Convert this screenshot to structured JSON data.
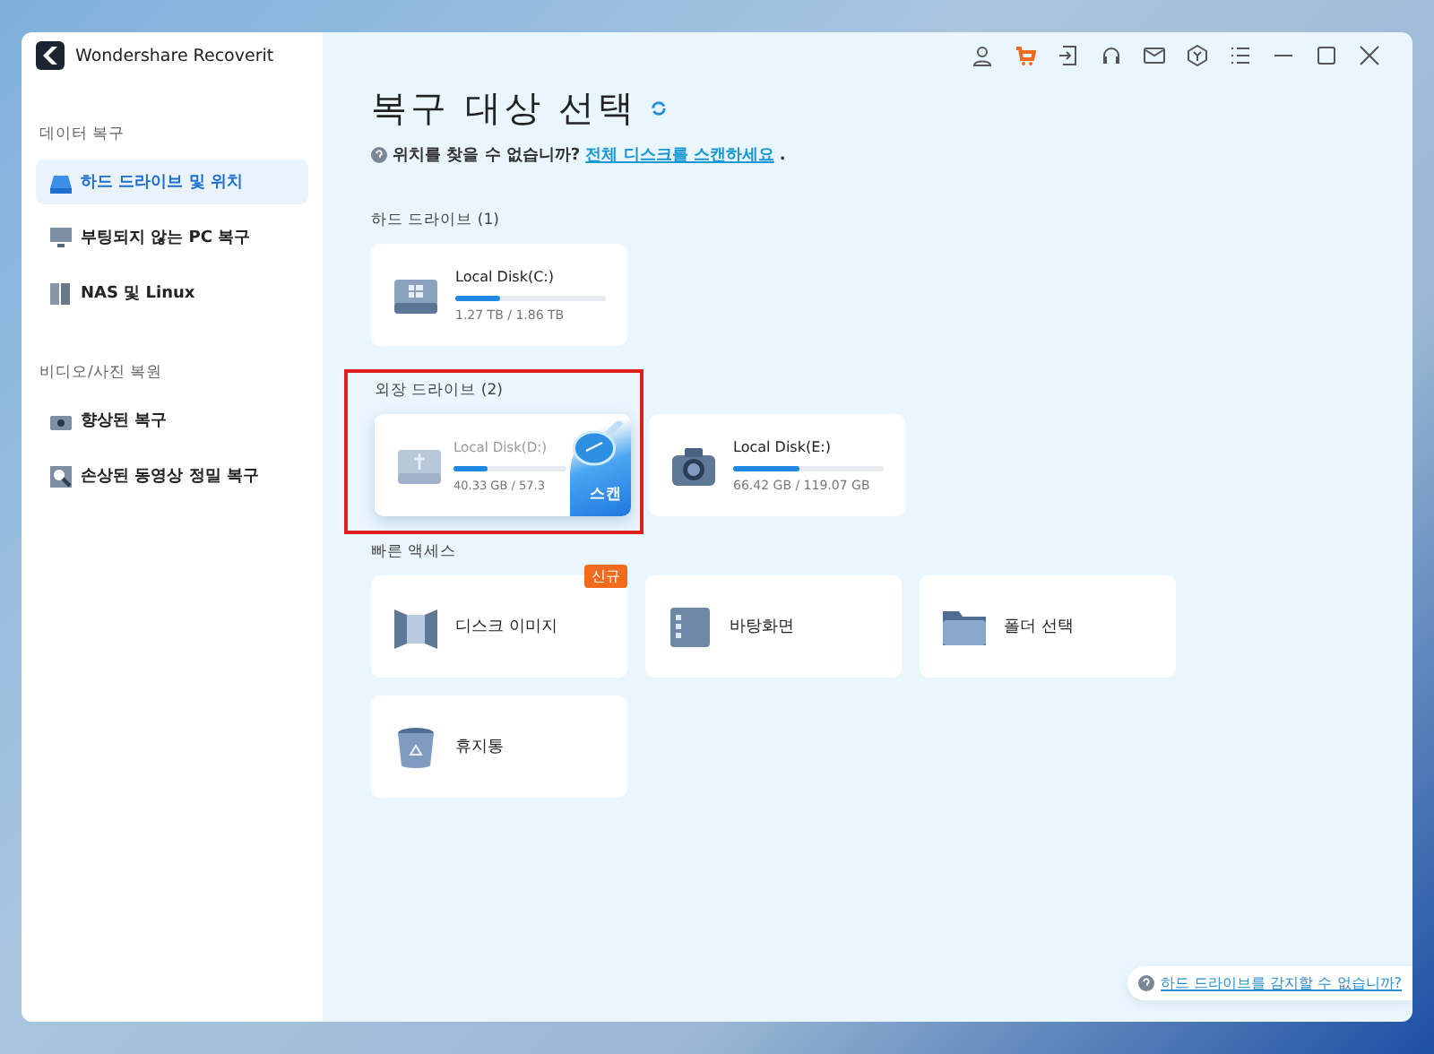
{
  "window": {
    "title": "Wondershare Recoverit"
  },
  "sidebar": {
    "sections": [
      {
        "heading": "데이터 복구",
        "items": [
          {
            "label": "하드 드라이브 및 위치",
            "kind": "drive",
            "selected": true
          },
          {
            "label": "부팅되지 않는 PC 복구",
            "kind": "monitor",
            "selected": false
          },
          {
            "label": "NAS 및 Linux",
            "kind": "nas",
            "selected": false
          }
        ]
      },
      {
        "heading": "비디오/사진 복원",
        "items": [
          {
            "label": "향상된 복구",
            "kind": "camera",
            "selected": false
          },
          {
            "label": "손상된 동영상 정밀 복구",
            "kind": "repair",
            "selected": false
          }
        ]
      }
    ]
  },
  "main": {
    "title": "복구 대상 선택",
    "hint": "위치를 찾을 수 없습니까?",
    "hint_link": "전체 디스크를 스캔하세요",
    "hint_end": ".",
    "groups": [
      {
        "heading": "하드 드라이브 (1)",
        "highlighted": false,
        "disks": [
          {
            "name": "Local Disk(C:)",
            "kind": "windows",
            "level": 0.3,
            "usage": "1.27 TB / 1.86 TB"
          }
        ]
      },
      {
        "heading": "외장 드라이브 (2)",
        "highlighted": true,
        "disks": [
          {
            "name": "Local Disk(D:)",
            "kind": "usb",
            "level": 0.3,
            "usage": "40.33 GB / 57.3",
            "scan_button": "스캔"
          },
          {
            "name": "Local Disk(E:)",
            "kind": "camera",
            "level": 0.44,
            "usage": "66.42 GB / 119.07 GB"
          }
        ]
      }
    ],
    "quick_access": {
      "heading": "빠른 액세스",
      "items": [
        {
          "label": "디스크 이미지",
          "kind": "image",
          "badge": "신규"
        },
        {
          "label": "바탕화면",
          "kind": "desktop"
        },
        {
          "label": "폴더 선택",
          "kind": "folder"
        },
        {
          "label": "휴지통",
          "kind": "trash"
        }
      ]
    },
    "footer_link": "하드 드라이브를 감지할 수 없습니까?"
  }
}
